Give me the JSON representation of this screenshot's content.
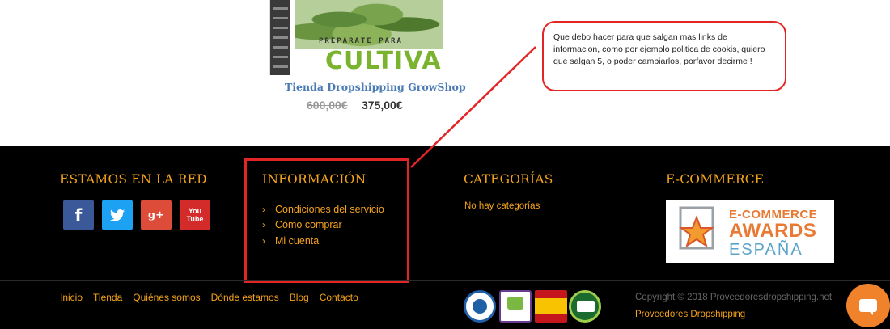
{
  "product": {
    "image_tagline": "PREPARATE PARA",
    "image_big_text": "CULTIVAR",
    "title": "Tienda Dropshipping GrowShop",
    "price_old": "600,00€",
    "price_new": "375,00€"
  },
  "callout": {
    "text": "Que debo hacer para que salgan mas links de informacion, como por ejemplo politica de cookis, quiero que salgan 5, o poder cambiarlos, porfavor decirme !"
  },
  "footer": {
    "social": {
      "title": "ESTAMOS EN LA RED",
      "facebook_glyph": "f",
      "twitter_glyph": "🐦",
      "gplus_glyph": "g+",
      "youtube_glyph_1": "You",
      "youtube_glyph_2": "Tube"
    },
    "info": {
      "title": "INFORMACIÓN",
      "items": [
        {
          "label": "Condiciones del servicio"
        },
        {
          "label": "Cómo comprar"
        },
        {
          "label": "Mi cuenta"
        }
      ],
      "chevron": "›"
    },
    "categories": {
      "title": "CATEGORÍAS",
      "empty_text": "No hay categorías"
    },
    "ecommerce": {
      "title": "E-COMMERCE",
      "award_line1": "E-COMMERCE",
      "award_line2": "AWARDS",
      "award_line3": "ESPAÑA"
    },
    "bottom_links": [
      "Inicio",
      "Tienda",
      "Quiénes somos",
      "Dónde estamos",
      "Blog",
      "Contacto"
    ],
    "copyright": "Copyright © 2018 Proveedoresdropshipping.net",
    "company_link": "Proveedores Dropshipping"
  },
  "colors": {
    "accent": "#f5a31a",
    "annotation_red": "#e32526",
    "chat": "#f0822b"
  }
}
